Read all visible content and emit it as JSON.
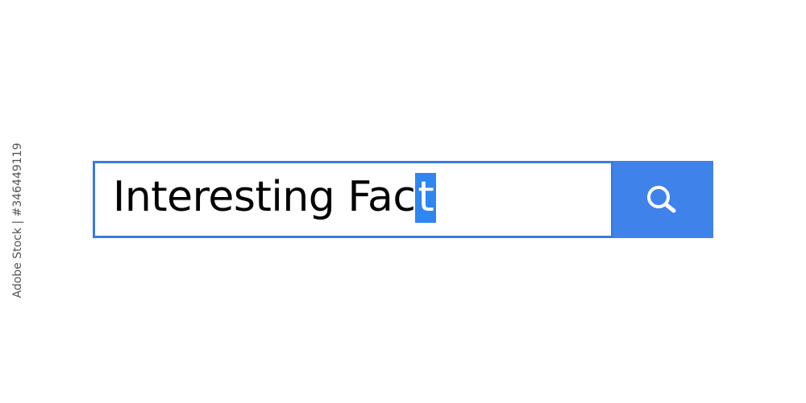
{
  "search": {
    "typed_text": "Interesting Fac",
    "selected_text": "t",
    "button_icon": "search-icon"
  },
  "side_text": "Adobe Stock | #346449119",
  "colors": {
    "accent": "#3f83ea",
    "field_border": "#3a7be0",
    "selection": "#2f86f0",
    "background": "#ffffff"
  }
}
